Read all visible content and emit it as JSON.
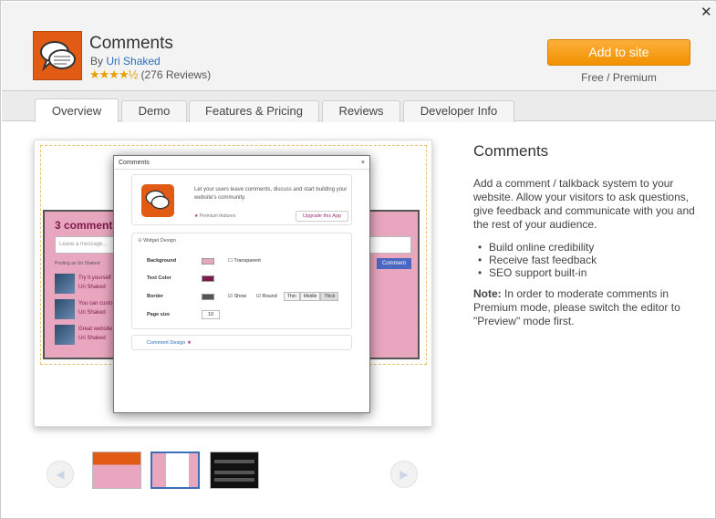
{
  "header": {
    "close_icon": "close-icon",
    "app_title": "Comments",
    "by_prefix": "By",
    "author": "Uri Shaked",
    "stars": "★★★★½",
    "reviews": "(276 Reviews)",
    "add_button": "Add to site",
    "price": "Free / Premium"
  },
  "tabs": [
    {
      "label": "Overview",
      "active": true
    },
    {
      "label": "Demo"
    },
    {
      "label": "Features & Pricing"
    },
    {
      "label": "Reviews"
    },
    {
      "label": "Developer Info"
    }
  ],
  "preview": {
    "widget_title": "3 comments",
    "widget_input": "Leave a message...",
    "widget_posting": "Posting as Uri Shaked",
    "widget_button": "Comment",
    "comments": [
      {
        "text": "Try it yourself",
        "author": "Uri Shaked"
      },
      {
        "text": "You can custo",
        "author": "Uri Shaked"
      },
      {
        "text": "Great website",
        "author": "Uri Shaked"
      }
    ],
    "dialog_title": "Comments",
    "dialog_close": "×",
    "dialog_desc": "Let your users leave comments, discuss and start building your website's community.",
    "dialog_premium": "Premium features",
    "dialog_upgrade": "Upgrade this App",
    "section_widget": "Widget Design",
    "row_background": "Background",
    "row_transparent": "Transparent",
    "row_textcolor": "Text Color",
    "row_border": "Border",
    "row_show": "Show",
    "row_round": "Round",
    "seg_thin": "Thin",
    "seg_middle": "Middle",
    "seg_thick": "Thick",
    "row_pagesize": "Page size",
    "pagesize_value": "10",
    "section_comment": "Comment Design"
  },
  "gallery": {
    "prev": "◀",
    "next": "▶"
  },
  "info": {
    "title": "Comments",
    "description": "Add a comment / talkback system to your website. Allow your visitors to ask questions, give feedback and communicate with you and the rest of your audience.",
    "bullets": [
      "Build online credibility",
      "Receive fast feedback",
      "SEO support built-in"
    ],
    "note_label": "Note:",
    "note_text": " In order to moderate comments in Premium mode, please switch the editor to \"Preview\" mode first."
  },
  "colors": {
    "accent": "#f29100",
    "link": "#2a6ebb",
    "icon_bg": "#e25b14"
  }
}
